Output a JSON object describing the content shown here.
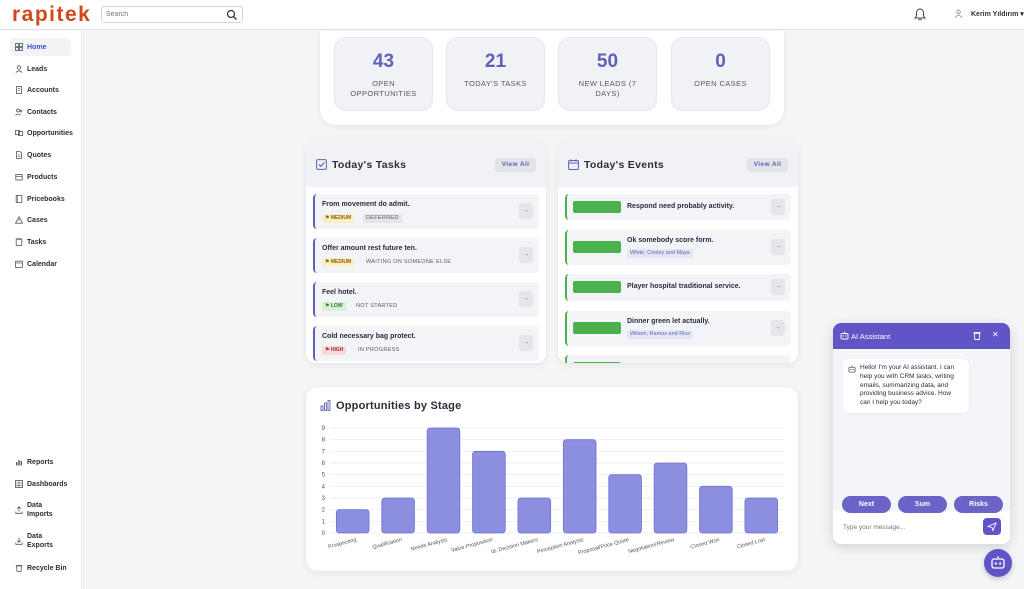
{
  "header": {
    "logo": "rapitek",
    "search_placeholder": "Search",
    "user_name": "Kerim Yıldırım ▾"
  },
  "sidebar": {
    "items": [
      {
        "label": "Home",
        "icon": "home-icon"
      },
      {
        "label": "Leads",
        "icon": "user-icon"
      },
      {
        "label": "Accounts",
        "icon": "building-icon"
      },
      {
        "label": "Contacts",
        "icon": "contacts-icon"
      },
      {
        "label": "Opportunities",
        "icon": "handshake-icon"
      },
      {
        "label": "Quotes",
        "icon": "document-icon"
      },
      {
        "label": "Products",
        "icon": "box-icon"
      },
      {
        "label": "Pricebooks",
        "icon": "book-icon"
      },
      {
        "label": "Cases",
        "icon": "warning-icon"
      },
      {
        "label": "Tasks",
        "icon": "clipboard-icon"
      },
      {
        "label": "Calendar",
        "icon": "calendar-icon"
      }
    ],
    "bottom_items": [
      {
        "label": "Reports",
        "icon": "chart-icon"
      },
      {
        "label": "Dashboards",
        "icon": "dashboard-icon"
      },
      {
        "label": "Data Imports",
        "icon": "upload-icon"
      },
      {
        "label": "Data Exports",
        "icon": "download-icon"
      },
      {
        "label": "Recycle Bin",
        "icon": "trash-icon"
      }
    ]
  },
  "stats": [
    {
      "value": "43",
      "label": "OPEN OPPORTUNITIES"
    },
    {
      "value": "21",
      "label": "TODAY'S TASKS"
    },
    {
      "value": "50",
      "label": "NEW LEADS (7 DAYS)"
    },
    {
      "value": "0",
      "label": "OPEN CASES"
    }
  ],
  "tasks_panel": {
    "title": "Today's Tasks",
    "view_all": "View All",
    "items": [
      {
        "title": "From movement do admit.",
        "priority": "MEDIUM",
        "priority_level": "medium",
        "status": "DEFERRED"
      },
      {
        "title": "Offer amount rest future ten.",
        "priority": "MEDIUM",
        "priority_level": "medium",
        "status": "WAITING ON SOMEONE ELSE"
      },
      {
        "title": "Feel hotel.",
        "priority": "LOW",
        "priority_level": "low",
        "status": "NOT STARTED"
      },
      {
        "title": "Cold necessary bag protect.",
        "priority": "HIGH",
        "priority_level": "high",
        "status": "IN PROGRESS"
      }
    ]
  },
  "events_panel": {
    "title": "Today's Events",
    "view_all": "View All",
    "items": [
      {
        "title": "Respond need probably activity.",
        "sub": ""
      },
      {
        "title": "Ok somebody score form.",
        "sub": "White, Cooley and Mays"
      },
      {
        "title": "Player hospital traditional service.",
        "sub": ""
      },
      {
        "title": "Dinner green let actually.",
        "sub": "Wilson, Ramos and Rice"
      }
    ]
  },
  "chart_panel": {
    "title": "Opportunities by Stage"
  },
  "chart_data": {
    "type": "bar",
    "title": "Opportunities by Stage",
    "categories": [
      "Prospecting",
      "Qualification",
      "Needs Analysis",
      "Value Proposition",
      "Id. Decision Makers",
      "Perception Analysis",
      "Proposal/Price Quote",
      "Negotiation/Review",
      "Closed Won",
      "Closed Lost"
    ],
    "values": [
      2,
      3,
      9,
      7,
      3,
      8,
      5,
      6,
      4,
      3
    ],
    "ylim": [
      0,
      9
    ],
    "yticks": [
      0,
      1,
      2,
      3,
      4,
      5,
      6,
      7,
      8,
      9
    ],
    "grid": true,
    "bar_color": "#8c8fe0"
  },
  "ai": {
    "title": "AI Assistant",
    "message": "Hello! I'm your AI assistant. I can help you with CRM tasks, writing emails, summarizing data, and providing business advice. How can I help you today?",
    "chips": [
      "Next",
      "Sum",
      "Risks"
    ],
    "input_placeholder": "Type your message..."
  },
  "colors": {
    "brand": "#d0481c",
    "accent": "#5d62b5",
    "ai_header": "#5f55c7",
    "event_green": "#4bb04e"
  }
}
